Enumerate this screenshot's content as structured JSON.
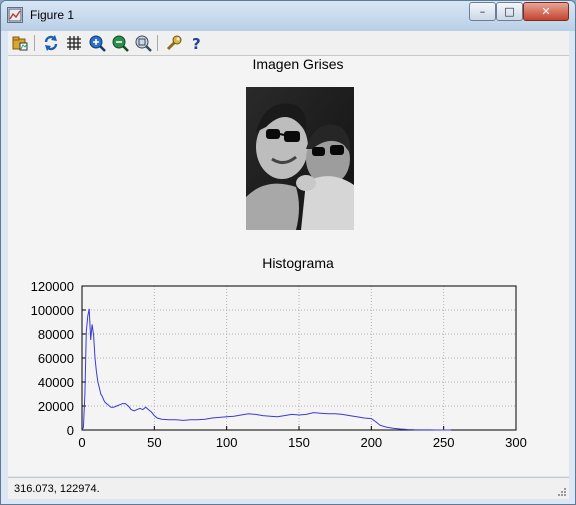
{
  "window": {
    "title": "Figure 1"
  },
  "toolbar": {
    "buttons": [
      {
        "name": "open-icon",
        "tooltip": "Open"
      },
      {
        "name": "refresh-icon",
        "tooltip": "Refresh"
      },
      {
        "name": "grid-icon",
        "tooltip": "Grid"
      },
      {
        "name": "zoom-in-icon",
        "tooltip": "Zoom in"
      },
      {
        "name": "zoom-out-icon",
        "tooltip": "Zoom out"
      },
      {
        "name": "zoom-fit-icon",
        "tooltip": "Autoscale"
      },
      {
        "name": "wrench-icon",
        "tooltip": "Properties"
      },
      {
        "name": "help-icon",
        "tooltip": "Help"
      }
    ]
  },
  "figure": {
    "image_title": "Imagen Grises",
    "histogram_title": "Histograma"
  },
  "status": {
    "coords": "316.073,  122974."
  },
  "colors": {
    "line": "#3a3ad6",
    "grid": "#b0b0b0"
  },
  "chart_data": {
    "type": "line",
    "title": "Histograma",
    "xlabel": "",
    "ylabel": "",
    "xlim": [
      0,
      300
    ],
    "ylim": [
      0,
      120000
    ],
    "xticks": [
      0,
      50,
      100,
      150,
      200,
      250,
      300
    ],
    "yticks": [
      0,
      20000,
      40000,
      60000,
      80000,
      100000,
      120000
    ],
    "grid": true,
    "series": [
      {
        "x": [
          0,
          1,
          2,
          3,
          4,
          5,
          6,
          7,
          8,
          9,
          10,
          11,
          12,
          13,
          14,
          15,
          16,
          18,
          20,
          22,
          24,
          26,
          28,
          30,
          32,
          34,
          36,
          38,
          40,
          42,
          44,
          46,
          48,
          50,
          52,
          55,
          60,
          65,
          70,
          75,
          80,
          85,
          90,
          95,
          100,
          105,
          110,
          115,
          120,
          125,
          130,
          135,
          140,
          145,
          150,
          155,
          160,
          165,
          170,
          175,
          180,
          185,
          190,
          195,
          200,
          203,
          206,
          210,
          215,
          220,
          225,
          230,
          235,
          240,
          245,
          250,
          255
        ],
        "y": [
          0,
          2000,
          30000,
          82000,
          95000,
          101000,
          75000,
          88000,
          79000,
          60000,
          48000,
          40000,
          35000,
          30000,
          28000,
          25000,
          23000,
          21000,
          19000,
          19000,
          20000,
          21000,
          22000,
          22000,
          20000,
          17000,
          16000,
          17000,
          18000,
          17000,
          19000,
          17000,
          15000,
          12000,
          10000,
          9000,
          8500,
          8500,
          8000,
          8500,
          8500,
          9000,
          10000,
          10500,
          11000,
          11500,
          12500,
          13500,
          13000,
          12000,
          11500,
          11000,
          12000,
          13000,
          12500,
          13000,
          14500,
          14000,
          13500,
          13500,
          13000,
          12000,
          11000,
          10000,
          9500,
          7000,
          4000,
          2500,
          1500,
          800,
          400,
          200,
          100,
          50,
          20,
          10,
          0
        ]
      }
    ]
  }
}
